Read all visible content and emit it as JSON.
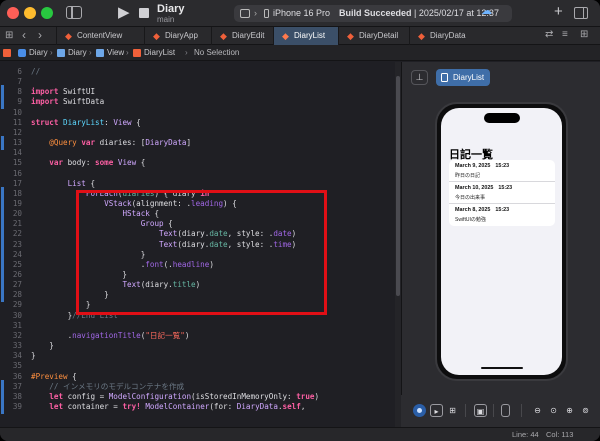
{
  "titlebar": {
    "project": "Diary",
    "branch": "main",
    "device": "iPhone 16 Pro",
    "status_bold": "Build Succeeded",
    "status_detail": " | 2025/02/17 at 12:37"
  },
  "tabs": [
    {
      "label": "ContentView",
      "active": false
    },
    {
      "label": "DiaryApp",
      "active": false
    },
    {
      "label": "DiaryEdit",
      "active": false
    },
    {
      "label": "DiaryList",
      "active": true
    },
    {
      "label": "DiaryDetail",
      "active": false
    },
    {
      "label": "DiaryData",
      "active": false
    }
  ],
  "breadcrumb": [
    "Diary",
    "Diary",
    "View",
    "DiaryList",
    "No Selection"
  ],
  "code_lines": [
    {
      "n": "6",
      "html": "<span class='cm'>//</span>",
      "changed": false
    },
    {
      "n": "7",
      "html": "",
      "changed": false
    },
    {
      "n": "8",
      "html": "<span class='kw'>import</span> SwiftUI",
      "changed": true
    },
    {
      "n": "9",
      "html": "<span class='kw'>import</span> SwiftData",
      "changed": true
    },
    {
      "n": "10",
      "html": "",
      "changed": false
    },
    {
      "n": "11",
      "html": "<span class='kw'>struct</span> <span class='ty'>DiaryList</span>: <span class='tyu'>View</span> {",
      "changed": false
    },
    {
      "n": "12",
      "html": "",
      "changed": false
    },
    {
      "n": "13",
      "html": "    <span class='mac'>@Query</span> <span class='kw'>var</span> diaries: [<span class='tyu'>DiaryData</span>]",
      "changed": true
    },
    {
      "n": "14",
      "html": "",
      "changed": false
    },
    {
      "n": "15",
      "html": "    <span class='kw'>var</span> body: <span class='kw'>some</span> <span class='tyu'>View</span> {",
      "changed": false
    },
    {
      "n": "16",
      "html": "",
      "changed": false
    },
    {
      "n": "17",
      "html": "        <span class='tyu'>List</span> {",
      "changed": false
    },
    {
      "n": "18",
      "html": "            <span class='tyu'>ForEach</span>(<span class='fn'>diaries</span>) { diary <span class='kw'>in</span>",
      "changed": true
    },
    {
      "n": "19",
      "html": "                <span class='tyu'>VStack</span>(alignment: .<span class='pw'>leading</span>) {",
      "changed": true
    },
    {
      "n": "20",
      "html": "                    <span class='tyu'>HStack</span> {",
      "changed": true
    },
    {
      "n": "21",
      "html": "                        <span class='tyu'>Group</span> {",
      "changed": true
    },
    {
      "n": "22",
      "html": "                            <span class='tyu'>Text</span>(diary.<span class='fn'>date</span>, style: .<span class='pw'>date</span>)",
      "changed": true
    },
    {
      "n": "23",
      "html": "                            <span class='tyu'>Text</span>(diary.<span class='fn'>date</span>, style: .<span class='pw'>time</span>)",
      "changed": true
    },
    {
      "n": "24",
      "html": "                        }",
      "changed": true
    },
    {
      "n": "25",
      "html": "                        .<span class='pw'>font</span>(.<span class='pw'>headline</span>)",
      "changed": true
    },
    {
      "n": "26",
      "html": "                    }",
      "changed": true
    },
    {
      "n": "27",
      "html": "                    <span class='tyu'>Text</span>(diary.<span class='fn'>title</span>)",
      "changed": true
    },
    {
      "n": "28",
      "html": "                }",
      "changed": true
    },
    {
      "n": "29",
      "html": "            }",
      "changed": false
    },
    {
      "n": "30",
      "html": "        }<span class='cm'>//End List</span>",
      "changed": false
    },
    {
      "n": "31",
      "html": "",
      "changed": false
    },
    {
      "n": "32",
      "html": "        .<span class='pw'>navigationTitle</span>(<span class='st'>\"日記一覧\"</span>)",
      "changed": false
    },
    {
      "n": "33",
      "html": "    }",
      "changed": false
    },
    {
      "n": "34",
      "html": "}",
      "changed": false
    },
    {
      "n": "35",
      "html": "",
      "changed": false
    },
    {
      "n": "36",
      "html": "<span class='mac'>#Preview</span> {",
      "changed": false
    },
    {
      "n": "37",
      "html": "    <span class='cm'>// インメモリのモデルコンテナを作成</span>",
      "changed": true
    },
    {
      "n": "38",
      "html": "    <span class='kw'>let</span> config = <span class='tyu'>ModelConfiguration</span>(isStoredInMemoryOnly: <span class='kw'>true</span>)",
      "changed": true
    },
    {
      "n": "39",
      "html": "    <span class='kw'>let</span> container = <span class='kw'>try!</span> <span class='tyu'>ModelContainer</span>(for: <span class='tyu'>DiaryData</span>.<span class='kw'>self</span>,",
      "changed": true
    }
  ],
  "preview": {
    "chip_label": "DiaryList",
    "nav_title": "日記一覧",
    "rows": [
      {
        "date": "March 9, 2025",
        "time": "15:23",
        "title": "昨日の日記"
      },
      {
        "date": "March 10, 2025",
        "time": "15:23",
        "title": "今日の出来事"
      },
      {
        "date": "March 8, 2025",
        "time": "15:23",
        "title": "SwiftUIの勉強"
      }
    ]
  },
  "status": {
    "line": "Line: 44",
    "col": "Col: 113"
  },
  "colors": {
    "highlight_box": "#e00f16",
    "active_tab": "#3b4f68",
    "swift_orange": "#f0603a"
  },
  "icons": {
    "run": "play-icon",
    "stop": "stop-icon",
    "sidebar": "sidebar-toggle-icon",
    "add": "plus-icon",
    "cloud": "cloud-icon"
  }
}
